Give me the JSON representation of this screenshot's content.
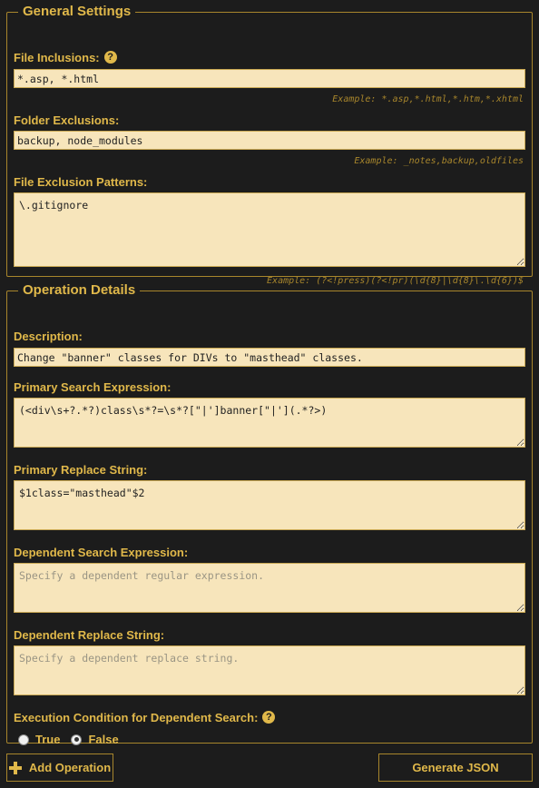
{
  "general": {
    "legend": "General Settings",
    "file_inclusions": {
      "label": "File Inclusions:",
      "value": "*.asp, *.html",
      "example": "Example: *.asp,*.html,*.htm,*.xhtml"
    },
    "folder_exclusions": {
      "label": "Folder Exclusions:",
      "value": "backup, node_modules",
      "example": "Example: _notes,backup,oldfiles"
    },
    "file_exclusion_patterns": {
      "label": "File Exclusion Patterns:",
      "value": "\\.gitignore",
      "example": "Example: (?<!press)(?<!pr)(\\d{8}|\\d{8}\\.\\d{6})$"
    }
  },
  "operation": {
    "legend": "Operation Details",
    "description": {
      "label": "Description:",
      "value": "Change \"banner\" classes for DIVs to \"masthead\" classes."
    },
    "primary_search": {
      "label": "Primary Search Expression:",
      "value": "(<div\\s+?.*?)class\\s*?=\\s*?[\"|']banner[\"|'](.*?>)"
    },
    "primary_replace": {
      "label": "Primary Replace String:",
      "value": "$1class=\"masthead\"$2"
    },
    "dependent_search": {
      "label": "Dependent Search Expression:",
      "placeholder": "Specify a dependent regular expression."
    },
    "dependent_replace": {
      "label": "Dependent Replace String:",
      "placeholder": "Specify a dependent replace string."
    },
    "execution_condition": {
      "label": "Execution Condition for Dependent Search:",
      "options": [
        {
          "label": "True",
          "checked": false
        },
        {
          "label": "False",
          "checked": true
        }
      ]
    }
  },
  "help_icon_glyph": "?",
  "buttons": {
    "add_operation": "Add Operation",
    "generate_json": "Generate JSON"
  },
  "colors": {
    "accent": "#e0b84a",
    "border": "#a8862c",
    "background": "#1c1c1c",
    "field_bg": "#f7e5bb"
  }
}
